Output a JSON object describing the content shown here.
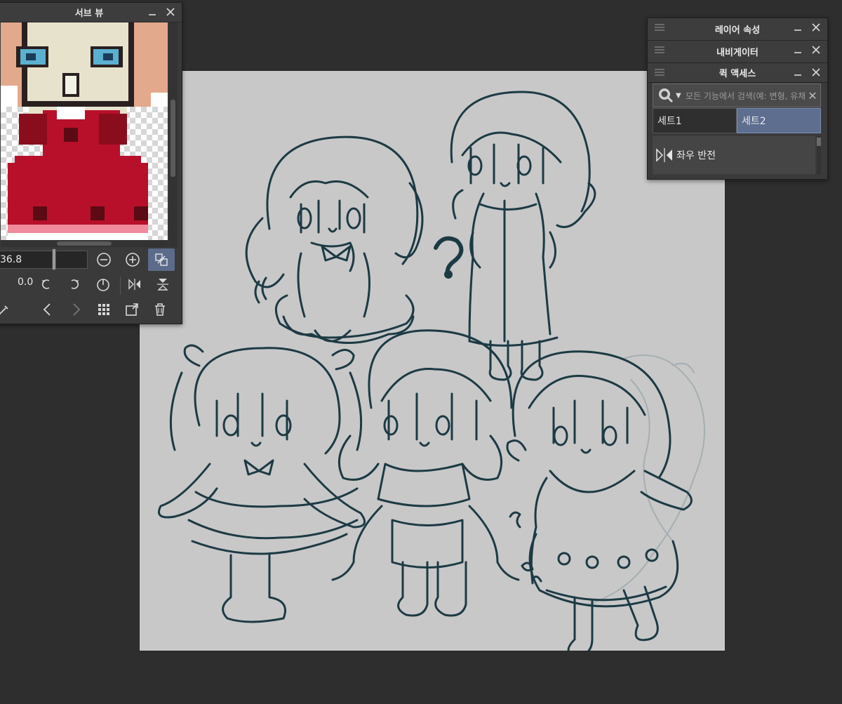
{
  "sub_view": {
    "title": "서브 뷰",
    "zoom_value": "36.8",
    "angle_value": "0.0"
  },
  "layer_props": {
    "title": "레이어 속성"
  },
  "navigator": {
    "title": "내비게이터"
  },
  "quick_access": {
    "title": "퀵 액세스",
    "search_placeholder": "모든 기능에서 검색(예: 변형, 유채 브",
    "tabs": [
      "세트1",
      "세트2"
    ],
    "selected_tab": "세트2",
    "items": [
      {
        "label": "좌우 반전",
        "icon": "flip-horizontal-icon"
      }
    ]
  },
  "colors": {
    "workspace_bg": "#2e2e2e",
    "canvas_bg": "#c8c8c8",
    "line_art": "#1c3a44",
    "accent": "#5d6e8f",
    "dress_red": "#b8102a",
    "skin": "#e3a98c"
  }
}
